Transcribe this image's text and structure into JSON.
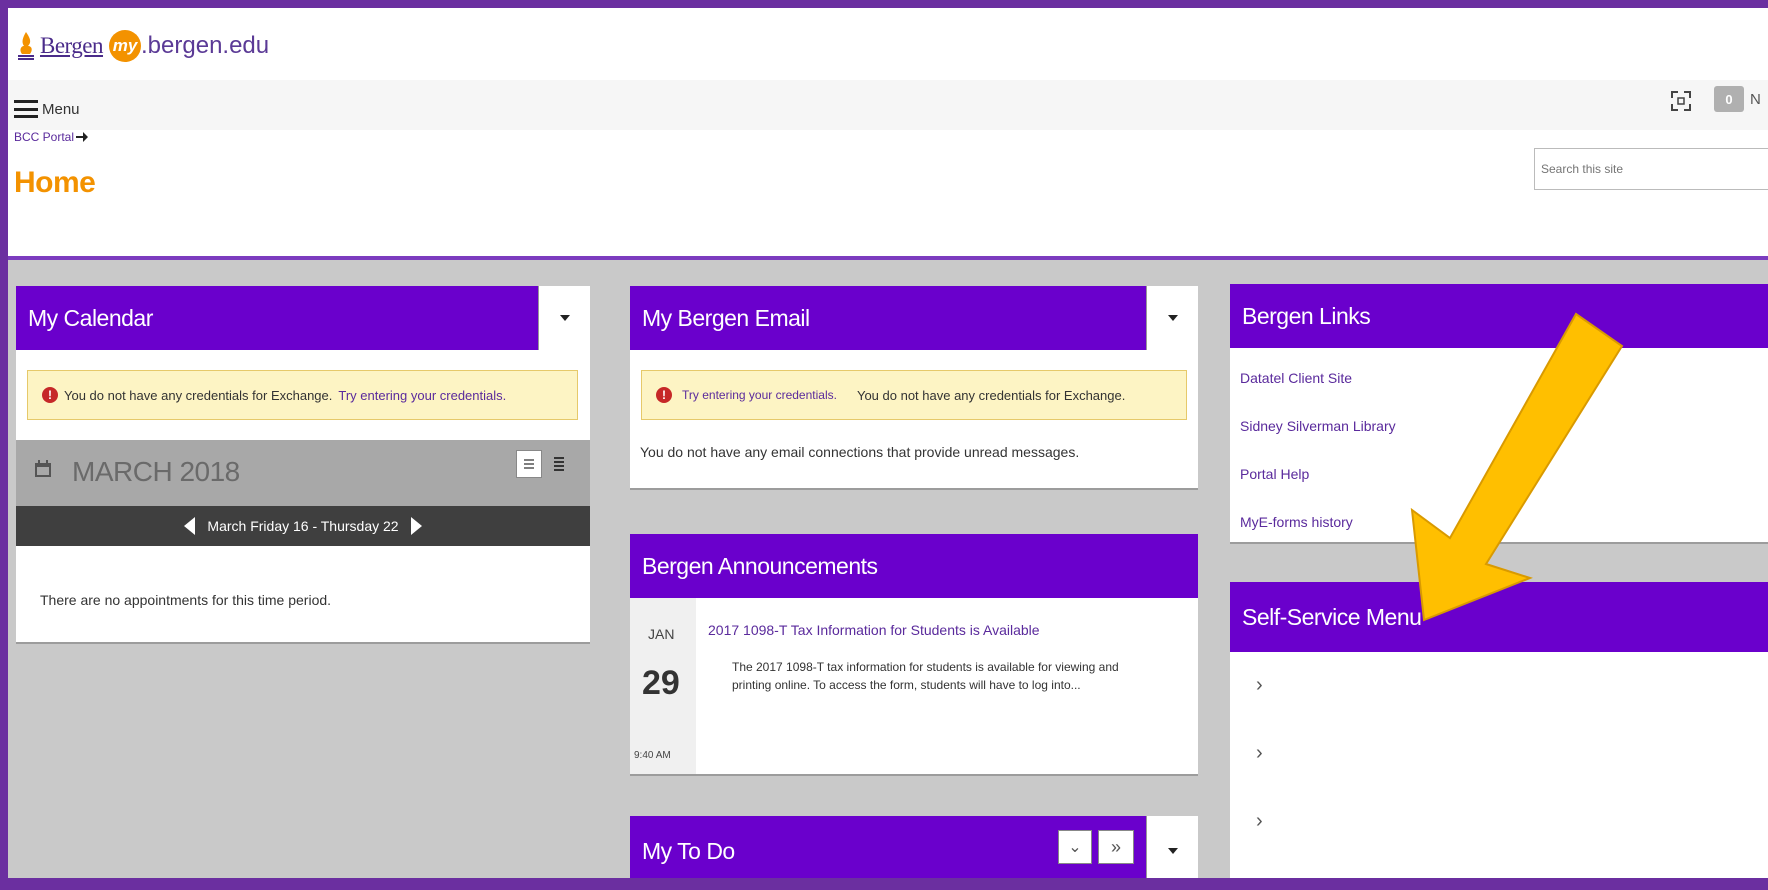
{
  "header": {
    "logo_left": "Bergen",
    "logo_badge": "my",
    "logo_domain": ".bergen.edu",
    "menu_label": "Menu",
    "breadcrumb": "BCC Portal",
    "page_title": "Home",
    "search_placeholder": "Search this site",
    "notification_count": "0",
    "notification_label": "N"
  },
  "calendar": {
    "title": "My Calendar",
    "alert_text": "You do not have any credentials for Exchange.",
    "alert_link": "Try entering your credentials.",
    "month": "MARCH 2018",
    "range": "March Friday 16 - Thursday 22",
    "empty_text": "There are no appointments for this time period."
  },
  "email": {
    "title": "My Bergen Email",
    "alert_link": "Try entering your credentials.",
    "alert_text": "You do not have any credentials for Exchange.",
    "body_text": "You do not have any email connections that provide unread messages."
  },
  "announcements": {
    "title": "Bergen Announcements",
    "items": [
      {
        "month": "JAN",
        "day": "29",
        "time": "9:40 AM",
        "headline": "2017 1098-T Tax Information for Students is Available",
        "summary_line1": "The 2017 1098-T tax information for students is available for viewing and",
        "summary_line2": "printing online. To access the form, students will have to log into..."
      }
    ]
  },
  "todo": {
    "title": "My To Do"
  },
  "links": {
    "title": "Bergen Links",
    "items": [
      "Datatel Client Site",
      "Sidney Silverman Library",
      "Portal Help",
      "MyE-forms history"
    ]
  },
  "self_service": {
    "title": "Self-Service Menu",
    "items": [
      "",
      "",
      ""
    ]
  },
  "colors": {
    "brand_purple": "#6a00cc",
    "accent_orange": "#f39200",
    "arrow_yellow": "#ffbf00",
    "frame_purple": "#6b2fa0"
  }
}
